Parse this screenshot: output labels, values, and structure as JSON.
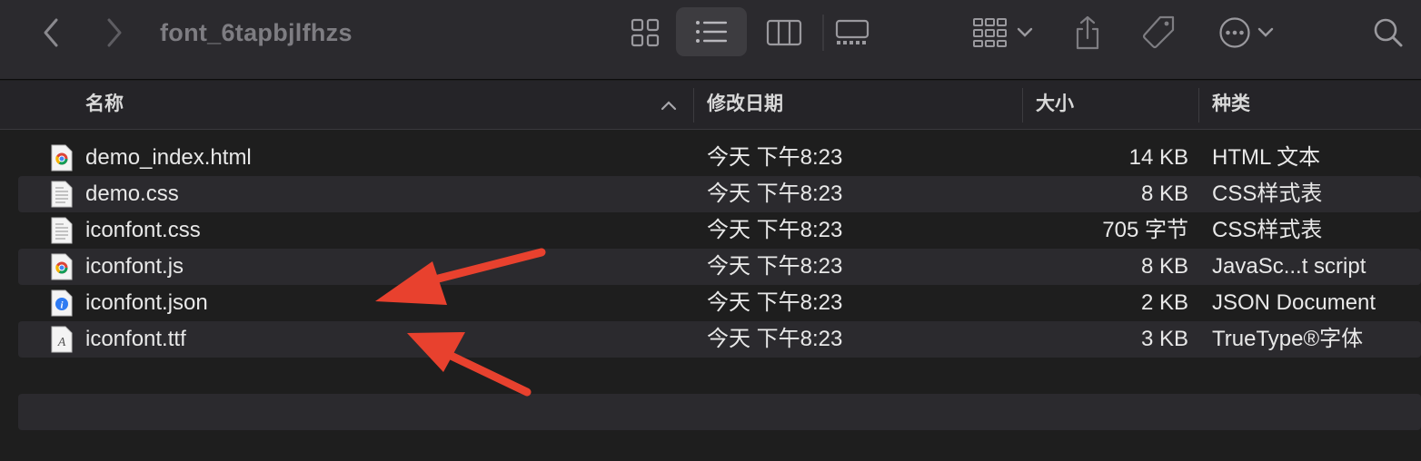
{
  "window": {
    "title": "font_6tapbjlfhzs"
  },
  "toolbar": {
    "back_icon": "chevron-left-icon",
    "forward_icon": "chevron-right-icon",
    "views": [
      "icon-grid-view",
      "list-view",
      "column-view",
      "gallery-view"
    ],
    "active_view": "list-view",
    "group_icon": "group-by-icon",
    "share_icon": "share-icon",
    "tag_icon": "tag-icon",
    "more_icon": "ellipsis-circle-icon",
    "search_icon": "search-icon"
  },
  "columns": {
    "name": "名称",
    "date": "修改日期",
    "size": "大小",
    "kind": "种类"
  },
  "files": [
    {
      "name": "demo_index.html",
      "date": "今天 下午8:23",
      "size": "14 KB",
      "kind": "HTML 文本",
      "icon": "chrome-document-icon"
    },
    {
      "name": "demo.css",
      "date": "今天 下午8:23",
      "size": "8 KB",
      "kind": "CSS样式表",
      "icon": "text-document-icon"
    },
    {
      "name": "iconfont.css",
      "date": "今天 下午8:23",
      "size": "705 字节",
      "kind": "CSS样式表",
      "icon": "text-document-icon"
    },
    {
      "name": "iconfont.js",
      "date": "今天 下午8:23",
      "size": "8 KB",
      "kind": "JavaSc...t script",
      "icon": "chrome-document-icon"
    },
    {
      "name": "iconfont.json",
      "date": "今天 下午8:23",
      "size": "2 KB",
      "kind": "JSON Document",
      "icon": "json-document-icon"
    },
    {
      "name": "iconfont.ttf",
      "date": "今天 下午8:23",
      "size": "3 KB",
      "kind": "TrueType®字体",
      "icon": "font-document-icon"
    }
  ],
  "annotations": {
    "arrow_color": "#e8412e"
  },
  "colors": {
    "toolbar_bg": "#2b2a2e",
    "list_bg": "#1e1e1e",
    "alt_row": "#2b2a2e"
  }
}
